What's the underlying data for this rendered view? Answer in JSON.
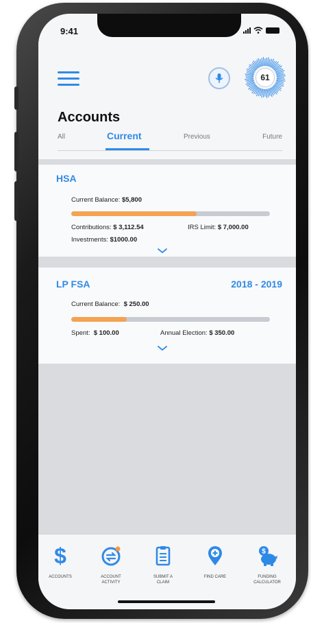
{
  "status_bar": {
    "time": "9:41"
  },
  "header": {
    "score": "61",
    "title": "Accounts",
    "tabs": [
      "All",
      "Current",
      "Previous",
      "Future"
    ]
  },
  "accounts": [
    {
      "name": "HSA",
      "balance_label": "Current Balance:",
      "balance": "$5,800",
      "progress": 0.63,
      "contributions_label": "Contributions:",
      "contributions": "$ 3,112.54",
      "limit_label": "IRS Limit:",
      "limit": "$ 7,000.00",
      "investments_label": "Investments:",
      "investments": "$1000.00"
    },
    {
      "name": "LP FSA",
      "years": "2018 - 2019",
      "balance_label": "Current Balance:",
      "balance": "$ 250.00",
      "progress": 0.28,
      "spent_label": "Spent:",
      "spent": "$ 100.00",
      "election_label": "Annual Election:",
      "election": "$ 350.00"
    }
  ],
  "tabbar": [
    {
      "label": "ACCOUNTS",
      "icon": "dollar-icon"
    },
    {
      "label": "ACCOUNT\nACTIVITY",
      "icon": "account-activity-icon"
    },
    {
      "label": "SUBMIT A\nCLAIM",
      "icon": "clipboard-icon"
    },
    {
      "label": "FIND CARE",
      "icon": "location-pin-icon"
    },
    {
      "label": "FUNDING\nCALCULATOR",
      "icon": "piggy-bank-icon"
    }
  ],
  "colors": {
    "accent": "#2f8ae6",
    "progress": "#f3a352",
    "track": "#c8ccd2",
    "badge": "#f39a3c"
  }
}
